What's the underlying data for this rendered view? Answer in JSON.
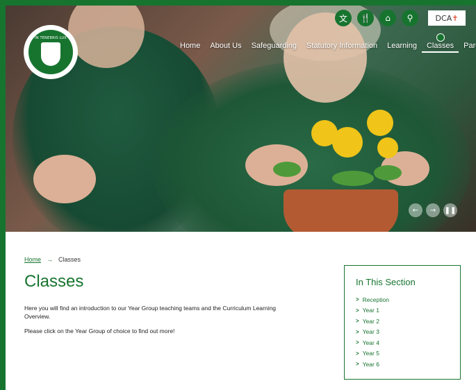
{
  "header": {
    "logo_motto": "IN TENEBRIS LUX",
    "dcat_label": "DCA",
    "dcat_cross": "✝",
    "utility_icons": [
      {
        "name": "translate-icon",
        "glyph": "文"
      },
      {
        "name": "lunch-icon",
        "glyph": "🍴"
      },
      {
        "name": "parents-icon",
        "glyph": "⌂"
      },
      {
        "name": "search-icon",
        "glyph": "⚲"
      }
    ],
    "nav": [
      {
        "label": "Home",
        "active": false
      },
      {
        "label": "About Us",
        "active": false
      },
      {
        "label": "Safeguarding",
        "active": false
      },
      {
        "label": "Statutory Information",
        "active": false
      },
      {
        "label": "Learning",
        "active": false
      },
      {
        "label": "Classes",
        "active": true
      },
      {
        "label": "Parents",
        "active": false
      }
    ]
  },
  "slider": {
    "prev": "←",
    "next": "→",
    "pause": "❚❚"
  },
  "breadcrumb": {
    "home": "Home",
    "separator": "→",
    "current": "Classes"
  },
  "main": {
    "title": "Classes",
    "paragraphs": [
      "Here you will find an introduction to our Year Group teaching teams and the Curriculum Learning Overview.",
      "Please click on the Year Group of choice to find out more!"
    ]
  },
  "section": {
    "title": "In This Section",
    "items": [
      "Reception",
      "Year 1",
      "Year 2",
      "Year 3",
      "Year 4",
      "Year 5",
      "Year 6"
    ]
  },
  "colors": {
    "brand_green": "#17742f",
    "accent_red": "#e04a2f"
  }
}
